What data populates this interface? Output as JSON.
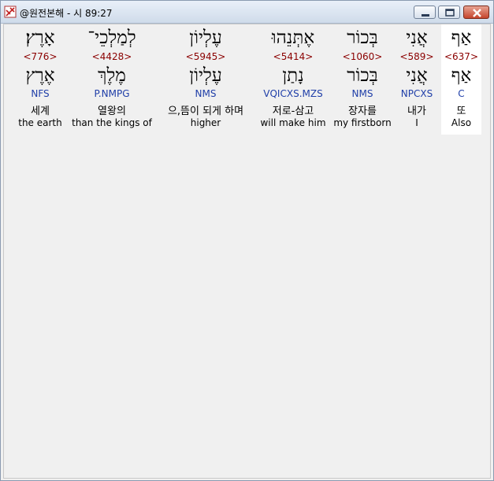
{
  "window": {
    "title": "@원전본해 - 시 89:27"
  },
  "words": [
    {
      "heb_pointed": "אַף",
      "strong": "<637>",
      "heb_lemma": "אַף",
      "morph": "C",
      "korean": "또",
      "english": "Also",
      "selected": true
    },
    {
      "heb_pointed": "אֲנִי",
      "strong": "<589>",
      "heb_lemma": "אֲנִי",
      "morph": "NPCXS",
      "korean": "내가",
      "english": "I",
      "selected": false
    },
    {
      "heb_pointed": "בְּכוֹר",
      "strong": "<1060>",
      "heb_lemma": "בְּכוֹר",
      "morph": "NMS",
      "korean": "장자를",
      "english": "my firstborn",
      "selected": false
    },
    {
      "heb_pointed": "אֶתְּנֵהוּ",
      "strong": "<5414>",
      "heb_lemma": "נָתַן",
      "morph": "VQICXS.MZS",
      "korean": "저로-삼고",
      "english": "will make him",
      "selected": false
    },
    {
      "heb_pointed": "עֶלְיוֹן",
      "strong": "<5945>",
      "heb_lemma": "עֶלְיוֹן",
      "morph": "NMS",
      "korean": "으,뜸이 되게 하며",
      "english": "higher",
      "selected": false
    },
    {
      "heb_pointed": "לְמַלְכֵי־",
      "strong": "<4428>",
      "heb_lemma": "מֶלֶךְ",
      "morph": "P.NMPG",
      "korean": "열왕의",
      "english": "than the kings of",
      "selected": false
    },
    {
      "heb_pointed": "אָרֶץ׃",
      "strong": "<776>",
      "heb_lemma": "אֶרֶץ",
      "morph": "NFS",
      "korean": "세계",
      "english": "the earth",
      "selected": false
    }
  ]
}
